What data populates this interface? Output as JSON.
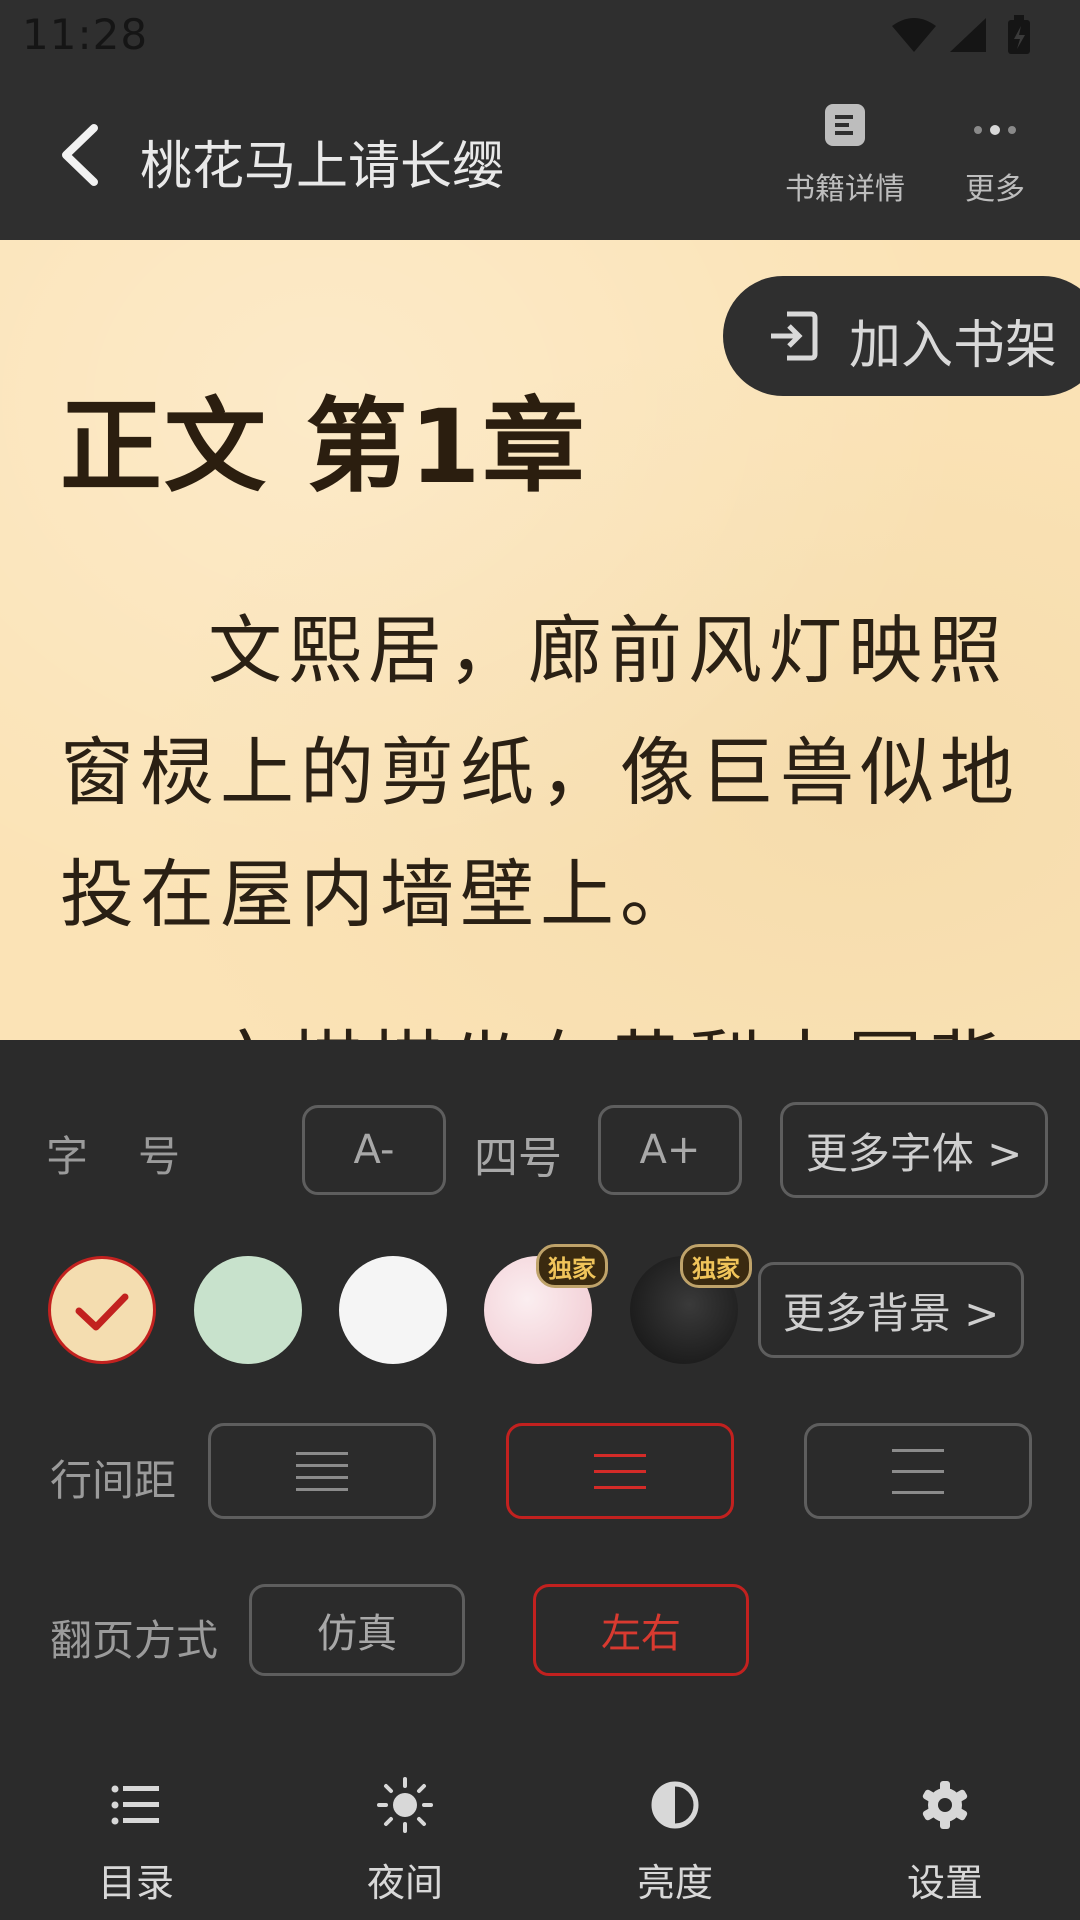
{
  "status_bar": {
    "time": "11:28"
  },
  "header": {
    "title": "桃花马上请长缨",
    "book_details_label": "书籍详情",
    "more_label": "更多"
  },
  "reader": {
    "add_shelf_label": "加入书架",
    "chapter_title": "正文 第1章",
    "paragraph": "文熙居，廊前风灯映照窗棂上的剪纸，像巨兽似地投在屋内墙壁上。",
    "partial_next_line": "文棋棋坐在黄梨木圆背椅"
  },
  "settings": {
    "font_size": {
      "label": "字　号",
      "decrease": "A-",
      "value": "四号",
      "increase": "A+",
      "more_fonts": "更多字体 >"
    },
    "backgrounds": {
      "options": [
        {
          "name": "beige",
          "color": "#f4ddb0",
          "selected": true
        },
        {
          "name": "green",
          "color": "#c8e2cc",
          "selected": false
        },
        {
          "name": "white",
          "color": "#f5f5f5",
          "selected": false
        },
        {
          "name": "pink",
          "color": "#f6dde0",
          "badge": "独家",
          "selected": false
        },
        {
          "name": "dark",
          "color": "#1c1c1c",
          "badge": "独家",
          "selected": false
        }
      ],
      "more_backgrounds": "更多背景 >"
    },
    "line_spacing": {
      "label": "行间距",
      "selected_index": 1
    },
    "page_turn": {
      "label": "翻页方式",
      "options": [
        "仿真",
        "左右"
      ],
      "selected_index": 1
    }
  },
  "bottom_nav": {
    "items": [
      {
        "label": "目录",
        "icon": "list-icon"
      },
      {
        "label": "夜间",
        "icon": "sun-icon"
      },
      {
        "label": "亮度",
        "icon": "contrast-icon"
      },
      {
        "label": "设置",
        "icon": "gear-icon"
      }
    ]
  },
  "colors": {
    "accent": "#c2211f",
    "paper": "#fbe3b6",
    "panel": "#2b2b2b"
  }
}
